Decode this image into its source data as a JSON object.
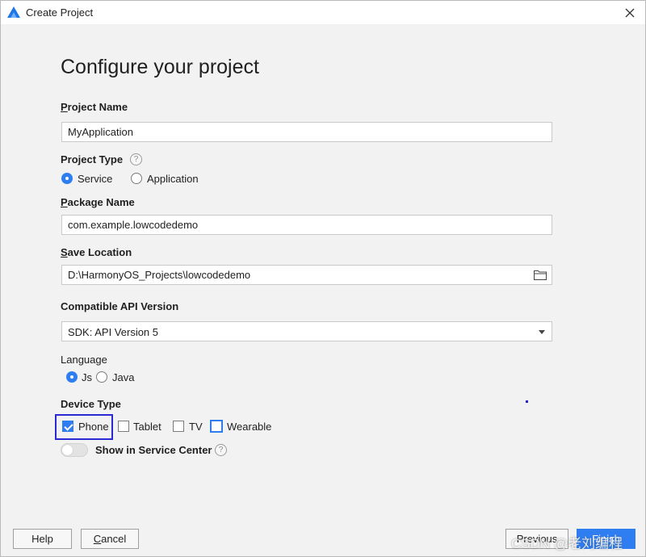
{
  "window": {
    "title": "Create Project"
  },
  "page": {
    "title": "Configure your project"
  },
  "project_name": {
    "label_mn": "P",
    "label_rest": "roject Name",
    "value": "MyApplication"
  },
  "project_type": {
    "label": "Project Type",
    "options": [
      {
        "label": "Service",
        "selected": true
      },
      {
        "label": "Application",
        "selected": false
      }
    ]
  },
  "package_name": {
    "label_mn": "P",
    "label_rest": "ackage Name",
    "value": "com.example.lowcodedemo"
  },
  "save_location": {
    "label_mn": "S",
    "label_rest": "ave Location",
    "value": "D:\\HarmonyOS_Projects\\lowcodedemo"
  },
  "api_version": {
    "label": "Compatible API Version",
    "selected": "SDK: API Version 5"
  },
  "language": {
    "label": "Language",
    "options": [
      {
        "label": "Js",
        "selected": true
      },
      {
        "label": "Java",
        "selected": false
      }
    ]
  },
  "device_type": {
    "label": "Device Type",
    "options": [
      {
        "label": "Phone",
        "checked": true
      },
      {
        "label": "Tablet",
        "checked": false
      },
      {
        "label": "TV",
        "checked": false
      },
      {
        "label": "Wearable",
        "checked": false
      }
    ]
  },
  "service_center": {
    "label": "Show in Service Center",
    "enabled": false
  },
  "footer": {
    "help": "Help",
    "cancel_mn": "C",
    "cancel_rest": "ancel",
    "previous": "Previous",
    "finish": "Finish"
  },
  "watermark": "CSDN @老刘编程",
  "colors": {
    "accent": "#2f7ef1",
    "focus": "#2a2ad4"
  }
}
